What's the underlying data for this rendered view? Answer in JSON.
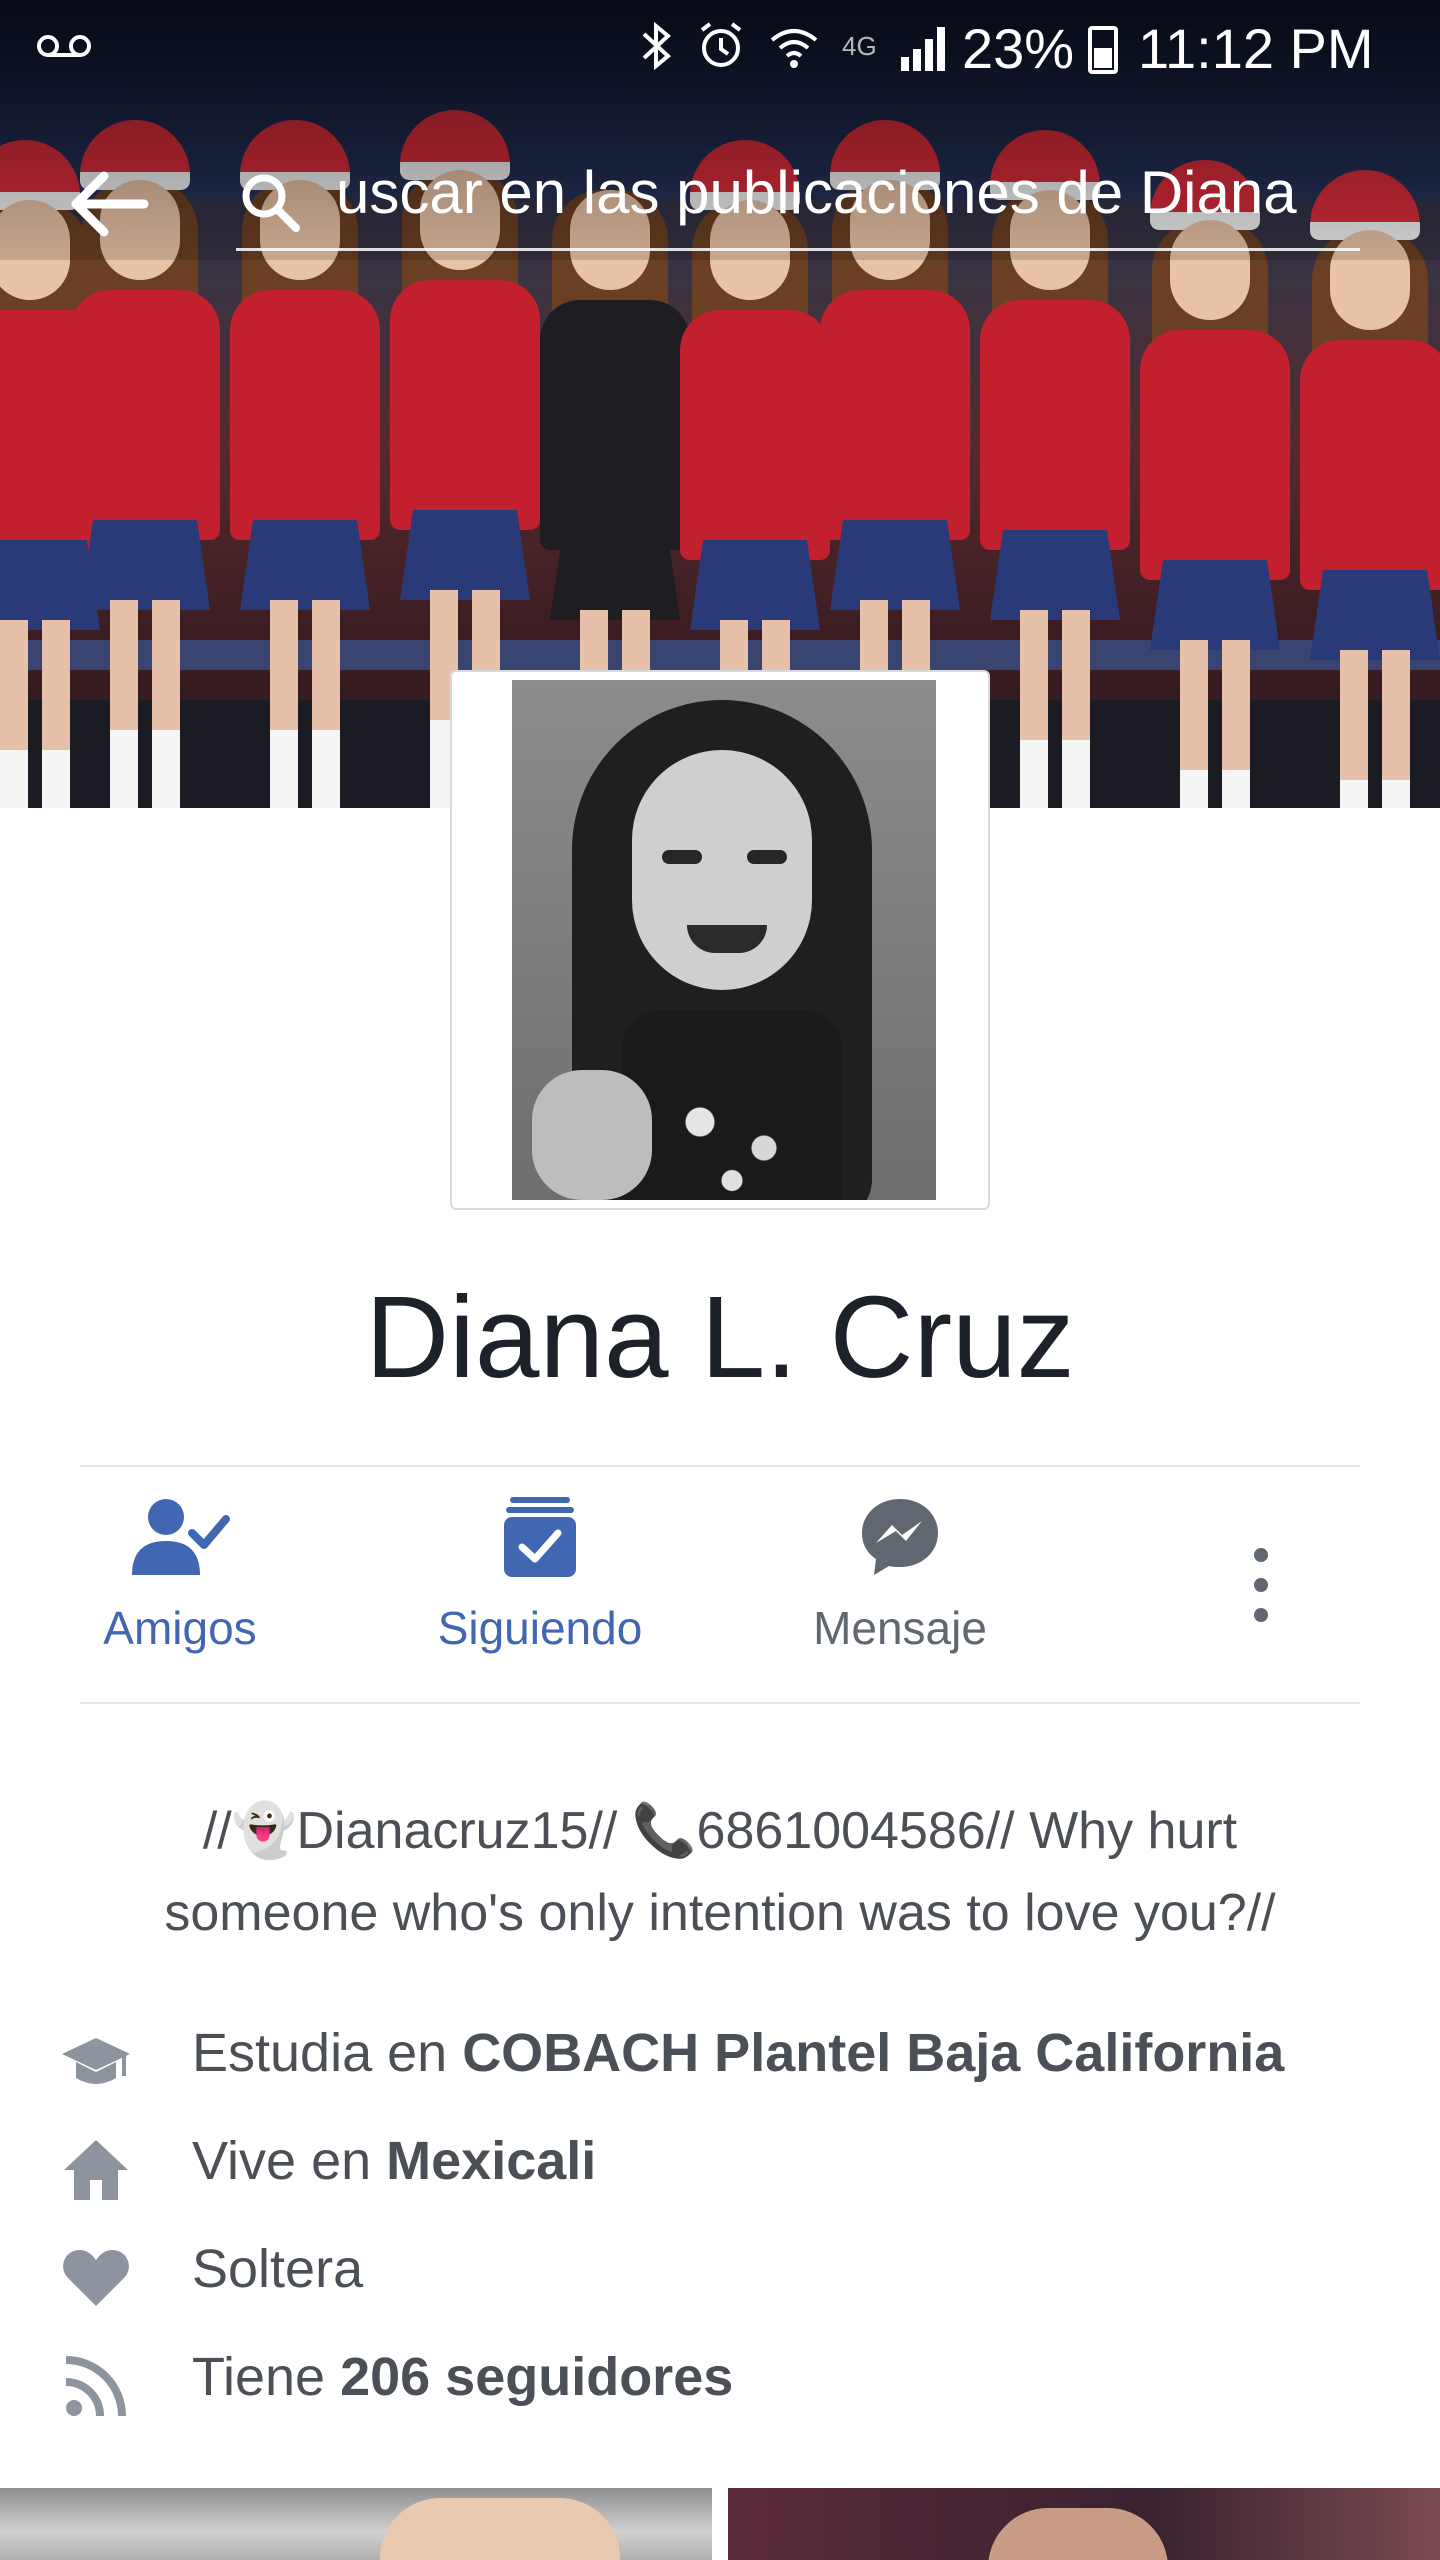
{
  "status_bar": {
    "battery": "23%",
    "time": "11:12 PM",
    "network": "4G"
  },
  "search": {
    "text": "uscar en las publicaciones de Diana"
  },
  "profile": {
    "name": "Diana L. Cruz"
  },
  "actions": {
    "friends": "Amigos",
    "following": "Siguiendo",
    "message": "Mensaje"
  },
  "bio": {
    "line1": "//👻Dianacruz15// 📞6861004586// Why hurt",
    "line2": "someone who's only intention was to love you?//"
  },
  "details": {
    "study_prefix": "Estudia en ",
    "study_place": "COBACH Plantel Baja California",
    "live_prefix": "Vive en ",
    "live_place": "Mexicali",
    "relationship": "Soltera",
    "followers_prefix": "Tiene ",
    "followers": "206 seguidores"
  },
  "colors": {
    "accent": "#4267b2",
    "secondary_text": "#606770",
    "icon_gray": "#8d949e"
  },
  "icons": {
    "back": "arrow-left-icon",
    "search": "search-icon",
    "friends": "friend-check-icon",
    "following": "following-check-icon",
    "message": "messenger-icon",
    "more": "more-vertical-icon",
    "study": "graduation-cap-icon",
    "home": "home-icon",
    "relationship": "heart-icon",
    "followers": "rss-icon"
  }
}
